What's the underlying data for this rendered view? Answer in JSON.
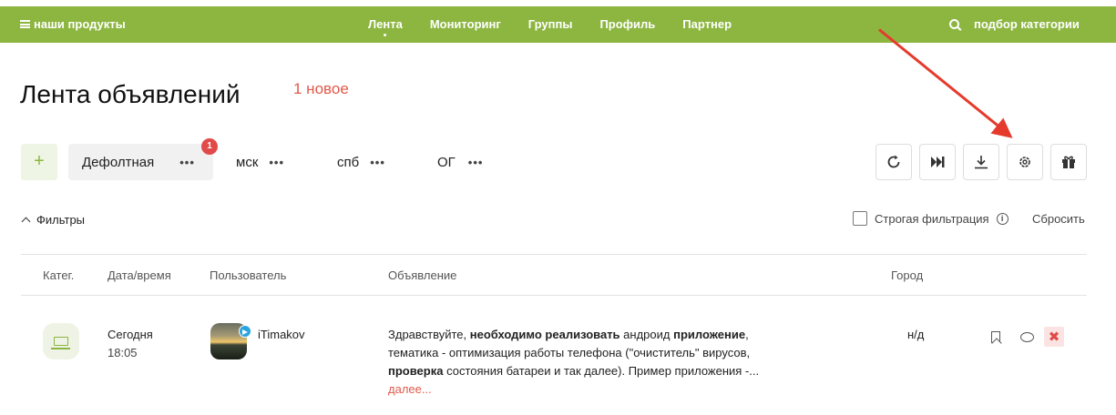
{
  "topbar": {
    "products_label": "наши продукты",
    "nav": [
      "Лента",
      "Мониторинг",
      "Группы",
      "Профиль",
      "Партнер"
    ],
    "active_nav": "Лента",
    "search_label": "подбор категории",
    "bg_color": "#8cb640"
  },
  "page": {
    "title": "Лента объявлений",
    "new_count": "1 новое"
  },
  "feeds": {
    "add_label": "+",
    "tabs": [
      {
        "label": "Дефолтная",
        "more": "•••",
        "badge": "1"
      },
      {
        "label": "мск",
        "more": "•••"
      },
      {
        "label": "спб",
        "more": "•••"
      },
      {
        "label": "ОГ",
        "more": "•••"
      }
    ]
  },
  "toolbar": {
    "icons": [
      "refresh-icon",
      "skip-forward-icon",
      "download-icon",
      "settings-icon",
      "gift-icon"
    ]
  },
  "filters": {
    "toggle_label": "Фильтры",
    "strict_label": "Строгая фильтрация",
    "info_glyph": "i",
    "reset_label": "Сбросить"
  },
  "table": {
    "headers": [
      "Катег.",
      "Дата/время",
      "Пользователь",
      "Объявление",
      "Город"
    ],
    "rows": [
      {
        "category_icon": "laptop-icon",
        "date": "Сегодня",
        "time": "18:05",
        "user": "iTimakov",
        "source_icon": "telegram-icon",
        "ad_parts": [
          {
            "t": "Здравствуйте, ",
            "b": false
          },
          {
            "t": "необходимо реализовать",
            "b": true
          },
          {
            "t": " андроид ",
            "b": false
          },
          {
            "t": "приложение",
            "b": true
          },
          {
            "t": ", тематика - оптимизация работы телефона (\"очиститель\" вирусов, ",
            "b": false
          },
          {
            "t": "проверка",
            "b": true
          },
          {
            "t": " состояния батареи и так далее). Пример приложения -...",
            "b": false
          }
        ],
        "more_label": "далее...",
        "city": "н/д",
        "delete_glyph": "✖"
      }
    ]
  },
  "colors": {
    "accent": "#8cb640",
    "alert": "#e24a4a",
    "annotation_arrow": "#e53a2c"
  }
}
